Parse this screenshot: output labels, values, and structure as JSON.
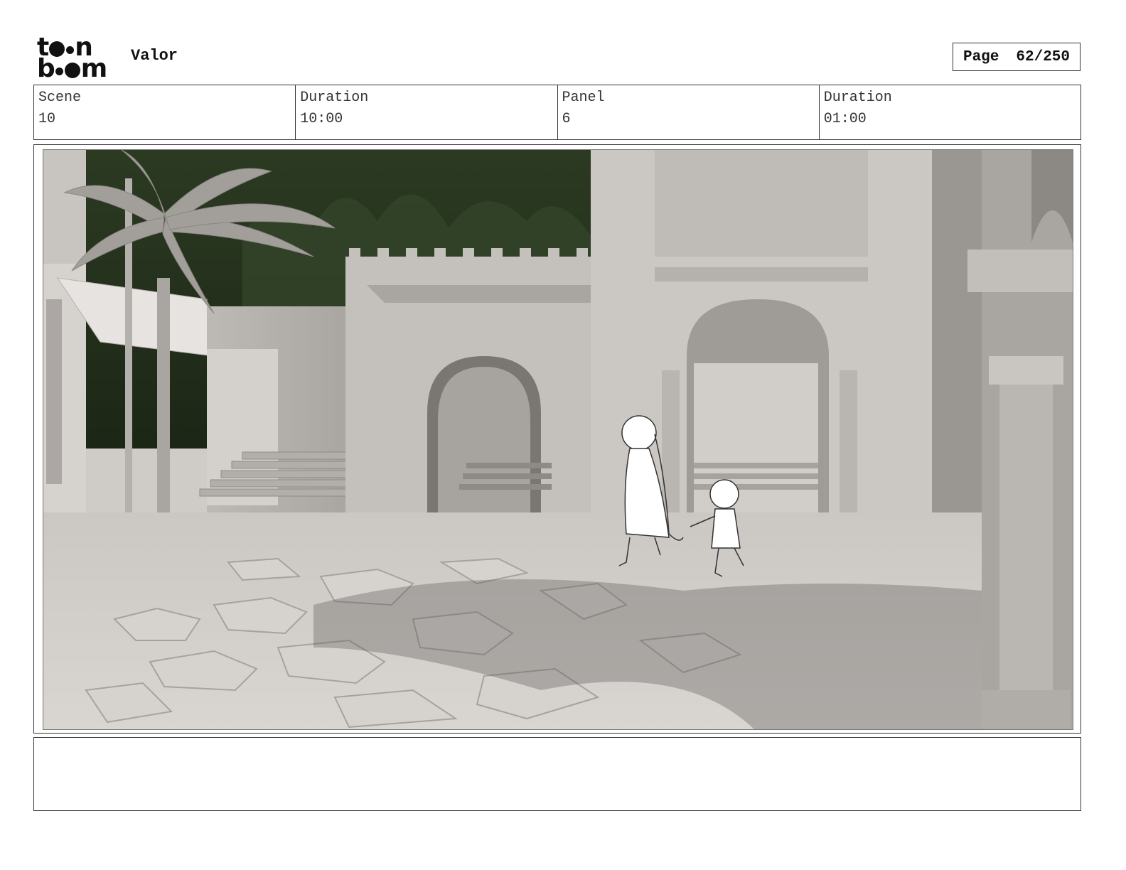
{
  "header": {
    "logo_text_top": "toon",
    "logo_text_bottom": "boom",
    "project_title": "Valor",
    "page_label": "Page",
    "page_number": "62/250"
  },
  "info": {
    "scene_label": "Scene",
    "scene_value": "10",
    "scene_duration_label": "Duration",
    "scene_duration_value": "10:00",
    "panel_label": "Panel",
    "panel_value": "6",
    "panel_duration_label": "Duration",
    "panel_duration_value": "01:00"
  },
  "notes": {
    "text": ""
  }
}
